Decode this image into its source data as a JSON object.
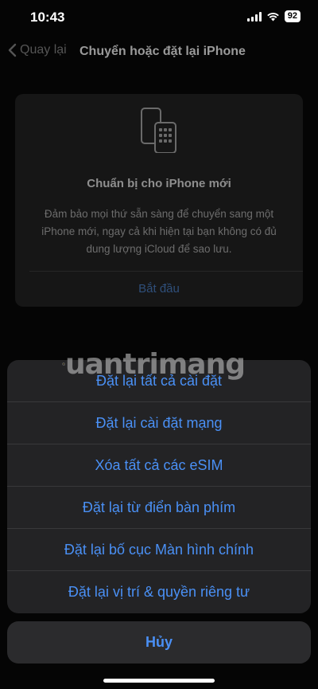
{
  "status_bar": {
    "time": "10:43",
    "battery": "92"
  },
  "nav": {
    "back_label": "Quay lại",
    "title": "Chuyển hoặc đặt lại iPhone"
  },
  "card": {
    "title": "Chuẩn bị cho iPhone mới",
    "description": "Đảm bảo mọi thứ sẵn sàng để chuyển sang một iPhone mới, ngay cả khi hiện tại bạn không có đủ dung lượng iCloud để sao lưu.",
    "start_label": "Bắt đầu"
  },
  "sheet": {
    "items": [
      "Đặt lại tất cả cài đặt",
      "Đặt lại cài đặt mạng",
      "Xóa tất cả các eSIM",
      "Đặt lại từ điển bàn phím",
      "Đặt lại bố cục Màn hình chính",
      "Đặt lại vị trí & quyền riêng tư"
    ],
    "cancel_label": "Hủy"
  },
  "watermark": "uantrimang",
  "colors": {
    "accent": "#4a90f5",
    "sheet_bg": "#232325"
  }
}
